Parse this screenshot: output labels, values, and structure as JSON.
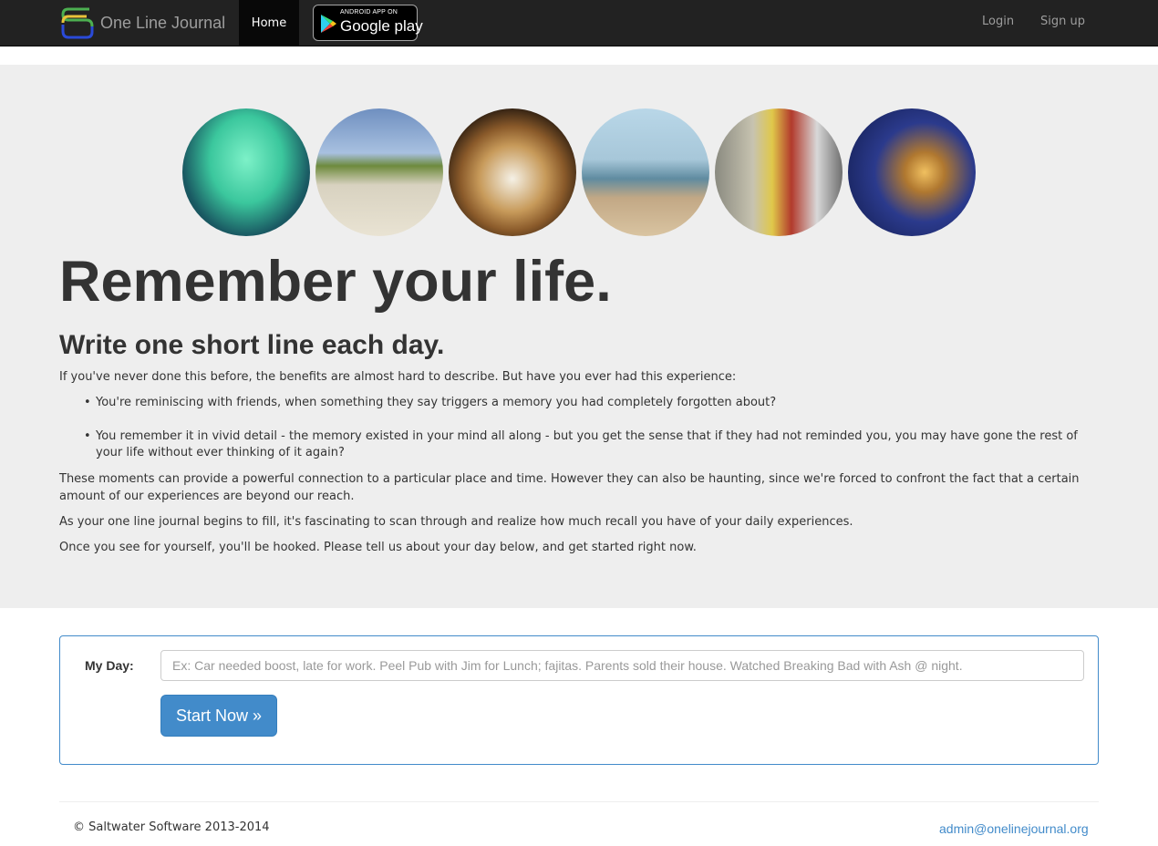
{
  "nav": {
    "brand": "One Line Journal",
    "home": "Home",
    "gplay_small": "ANDROID APP ON",
    "gplay_big": "Google play",
    "login": "Login",
    "signup": "Sign up"
  },
  "hero": {
    "title": "Remember your life.",
    "subtitle": "Write one short line each day.",
    "intro": "If you've never done this before, the benefits are almost hard to describe. But have you ever had this experience:",
    "bullets": [
      "You're reminiscing with friends, when something they say triggers a memory you had completely forgotten about?",
      "You remember it in vivid detail - the memory existed in your mind all along - but you get the sense that if they had not reminded you, you may have gone the rest of your life without ever thinking of it again?"
    ],
    "bullet_glyph": "•",
    "moments": "These moments can provide a powerful connection to a particular place and time. However they can also be haunting, since we're forced to confront the fact that a certain amount of our experiences are beyond our reach.",
    "fill": "As your one line journal begins to fill, it's fascinating to scan through and realize how much recall you have of your daily experiences.",
    "once": "Once you see for yourself, you'll be hooked. Please tell us about your day below, and get started right now."
  },
  "form": {
    "label": "My Day:",
    "placeholder": "Ex: Car needed boost, late for work. Peel Pub with Jim for Lunch; fajitas. Parents sold their house. Watched Breaking Bad with Ash @ night.",
    "button": "Start Now »"
  },
  "footer": {
    "copyright": "© Saltwater Software 2013-2014",
    "email": "admin@onelinejournal.org"
  },
  "colors": {
    "navbar": "#222222",
    "jumbotron": "#eeeeee",
    "primary": "#428bca"
  },
  "icons": {
    "logo": "one-line-journal-logo-icon",
    "play": "google-play-triangle-icon"
  }
}
